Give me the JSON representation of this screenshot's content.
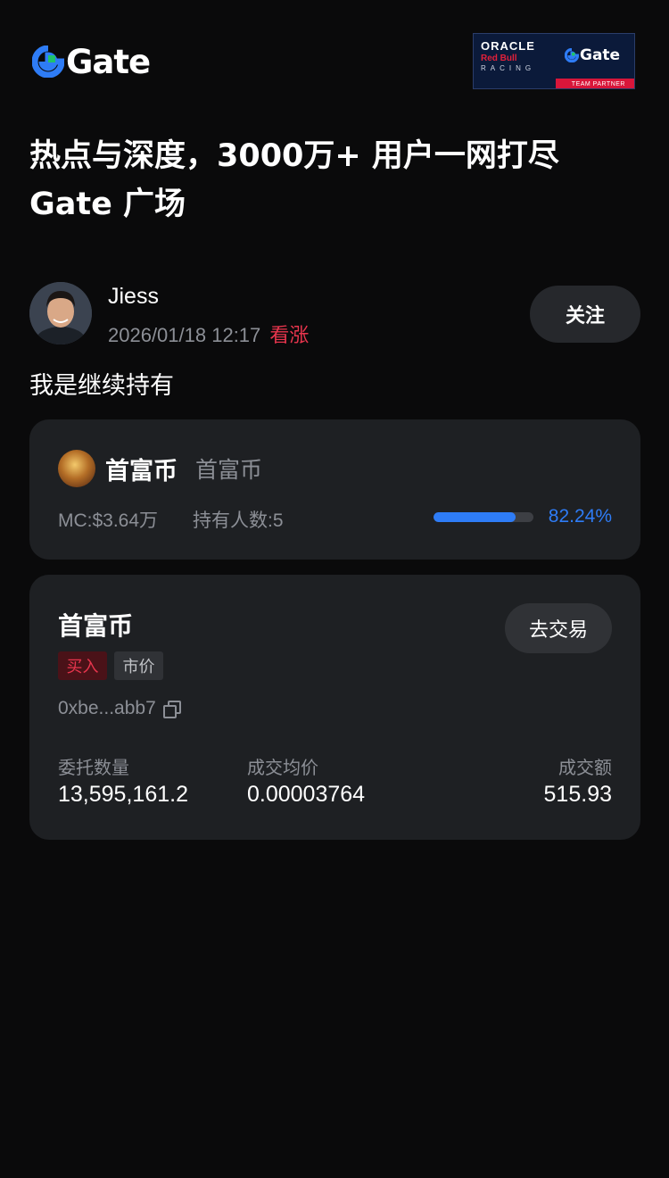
{
  "header": {
    "logo_text": "Gate",
    "partner": {
      "oracle": "ORACLE",
      "redbull": "Red Bull",
      "racing": "RACING",
      "gate": "Gate",
      "team": "TEAM PARTNER"
    }
  },
  "headline": {
    "line1": "热点与深度，3000万+ 用户一网打尽",
    "line2": "Gate 广场"
  },
  "author": {
    "name": "Jiess",
    "datetime": "2026/01/18 12:17",
    "sentiment": "看涨",
    "follow_label": "关注"
  },
  "post": {
    "text": "我是继续持有"
  },
  "token": {
    "name": "首富币",
    "subname": "首富币",
    "market_cap": "MC:$3.64万",
    "holders": "持有人数:5",
    "progress_percent": 82.24,
    "progress_label": "82.24%"
  },
  "trade": {
    "title": "首富币",
    "action_label": "去交易",
    "side_badge": "买入",
    "type_badge": "市价",
    "address": "0xbe...abb7",
    "stats": [
      {
        "label": "委托数量",
        "value": "13,595,161.2"
      },
      {
        "label": "成交均价",
        "value": "0.00003764"
      },
      {
        "label": "成交额",
        "value": "515.93"
      }
    ]
  },
  "colors": {
    "background": "#0a0a0b",
    "card": "#1e2023",
    "accent_blue": "#2e7cf6",
    "bullish_red": "#e8354d",
    "muted_text": "#8c8f96"
  }
}
